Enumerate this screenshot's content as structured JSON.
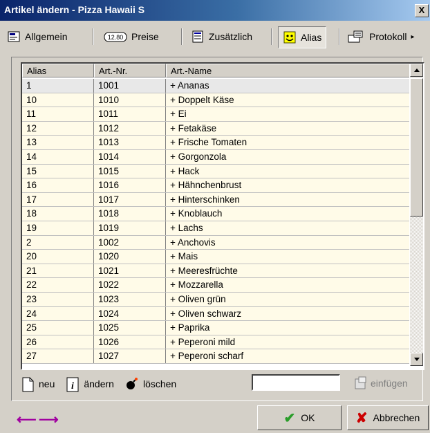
{
  "window": {
    "title": "Artikel ändern - Pizza Hawaii S",
    "close_glyph": "X"
  },
  "tabs": [
    {
      "label": "Allgemein",
      "icon": "general-icon"
    },
    {
      "label": "Preise",
      "icon": "price-tag-icon",
      "icon_text": "12.80"
    },
    {
      "label": "Zusätzlich",
      "icon": "document-list-icon"
    },
    {
      "label": "Alias",
      "icon": "mask-icon",
      "active": true
    },
    {
      "label": "Protokoll",
      "icon": "log-icon"
    }
  ],
  "grid": {
    "columns": [
      "Alias",
      "Art.-Nr.",
      "Art.-Name"
    ],
    "rows": [
      {
        "alias": "1",
        "nr": "1001",
        "name": "+ Ananas"
      },
      {
        "alias": "10",
        "nr": "1010",
        "name": "+ Doppelt Käse"
      },
      {
        "alias": "11",
        "nr": "1011",
        "name": "+ Ei"
      },
      {
        "alias": "12",
        "nr": "1012",
        "name": "+ Fetakäse"
      },
      {
        "alias": "13",
        "nr": "1013",
        "name": "+ Frische Tomaten"
      },
      {
        "alias": "14",
        "nr": "1014",
        "name": "+ Gorgonzola"
      },
      {
        "alias": "15",
        "nr": "1015",
        "name": "+ Hack"
      },
      {
        "alias": "16",
        "nr": "1016",
        "name": "+ Hähnchenbrust"
      },
      {
        "alias": "17",
        "nr": "1017",
        "name": "+ Hinterschinken"
      },
      {
        "alias": "18",
        "nr": "1018",
        "name": "+ Knoblauch"
      },
      {
        "alias": "19",
        "nr": "1019",
        "name": "+ Lachs"
      },
      {
        "alias": "2",
        "nr": "1002",
        "name": "+ Anchovis"
      },
      {
        "alias": "20",
        "nr": "1020",
        "name": "+ Mais"
      },
      {
        "alias": "21",
        "nr": "1021",
        "name": "+ Meeresfrüchte"
      },
      {
        "alias": "22",
        "nr": "1022",
        "name": "+ Mozzarella"
      },
      {
        "alias": "23",
        "nr": "1023",
        "name": "+ Oliven grün"
      },
      {
        "alias": "24",
        "nr": "1024",
        "name": "+ Oliven schwarz"
      },
      {
        "alias": "25",
        "nr": "1025",
        "name": "+ Paprika"
      },
      {
        "alias": "26",
        "nr": "1026",
        "name": "+ Peperoni mild"
      },
      {
        "alias": "27",
        "nr": "1027",
        "name": "+ Peperoni scharf"
      }
    ],
    "selected_row": 0
  },
  "actions": {
    "new_label": "neu",
    "edit_label": "ändern",
    "delete_label": "löschen",
    "insert_label": "einfügen",
    "alias_input_value": ""
  },
  "buttons": {
    "ok_label": "OK",
    "cancel_label": "Abbrechen"
  },
  "colors": {
    "row_bg": "#fffbe8",
    "selected_row_bg": "#e8e8e8",
    "nav_arrows": "#a000a0",
    "title_gradient_start": "#0a246a"
  }
}
